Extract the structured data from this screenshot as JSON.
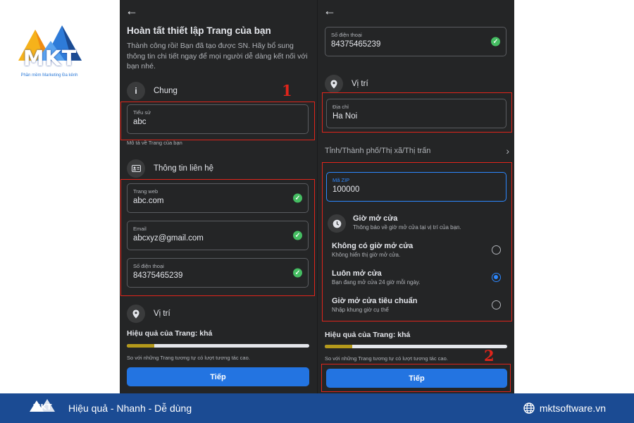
{
  "brand": {
    "logo_text": "MKT",
    "logo_subtext": "Phần mềm Marketing Đa kênh"
  },
  "annotations": {
    "marker_1": "1",
    "marker_2": "2"
  },
  "screen1": {
    "title": "Hoàn tất thiết lập Trang của bạn",
    "intro": "Thành công rồi! Bạn đã tạo được SN. Hãy bổ sung thông tin chi tiết ngay để mọi người dễ dàng kết nối với bạn nhé.",
    "section_general": {
      "label": "Chung",
      "icon": "info-icon"
    },
    "bio": {
      "label": "Tiểu sử",
      "value": "abc",
      "helper": "Mô tả về Trang của bạn"
    },
    "section_contact": {
      "label": "Thông tin liên hệ",
      "icon": "contact-card-icon"
    },
    "website": {
      "label": "Trang web",
      "value": "abc.com"
    },
    "email": {
      "label": "Email",
      "value": "abcxyz@gmail.com"
    },
    "phone": {
      "label": "Số điện thoại",
      "value": "84375465239"
    },
    "section_location": {
      "label": "Vị trí",
      "icon": "location-pin-icon"
    },
    "score_label": "Hiệu quả của Trang: khá",
    "score_progress": 0.15,
    "score_note": "So với những Trang tương tự có lượt tương tác cao.",
    "next_button": "Tiếp"
  },
  "screen2": {
    "phone": {
      "label": "Số điện thoại",
      "value": "84375465239"
    },
    "section_location": {
      "label": "Vị trí",
      "icon": "location-pin-icon"
    },
    "address": {
      "label": "Địa chỉ",
      "value": "Ha Noi"
    },
    "city_link": "Tỉnh/Thành phố/Thị xã/Thị trấn",
    "zip": {
      "label": "Mã ZIP",
      "value": "100000"
    },
    "hours": {
      "title": "Giờ mở cửa",
      "subtitle": "Thông báo về giờ mở cửa tại vị trí của bạn.",
      "options": [
        {
          "title": "Không có giờ mở cửa",
          "subtitle": "Không hiển thị giờ mở cửa.",
          "selected": false
        },
        {
          "title": "Luôn mở cửa",
          "subtitle": "Bạn đang mở cửa 24 giờ mỗi ngày.",
          "selected": true
        },
        {
          "title": "Giờ mở cửa tiêu chuẩn",
          "subtitle": "Nhập khung giờ cụ thể",
          "selected": false
        }
      ]
    },
    "score_label": "Hiệu quả của Trang: khá",
    "score_progress": 0.15,
    "score_note": "So với những Trang tương tự có lượt tương tác cao.",
    "next_button": "Tiếp"
  },
  "footer": {
    "tagline": "Hiệu quả - Nhanh - Dễ dùng",
    "website": "mktsoftware.vn",
    "logo_text": "MKT"
  },
  "colors": {
    "phone_bg": "#242526",
    "accent_blue": "#2374e1",
    "annotation_red": "#e0251b",
    "success_green": "#45bd62",
    "footer_bg": "#1b4b93",
    "progress_fill": "#b59a1b"
  }
}
